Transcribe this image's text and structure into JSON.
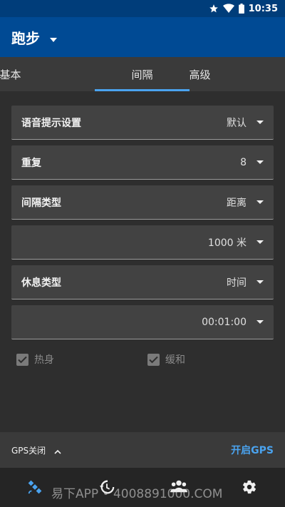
{
  "status_bar": {
    "time": "10:35"
  },
  "app_bar": {
    "title": "跑步"
  },
  "tabs": [
    {
      "label": "基本"
    },
    {
      "label": "间隔"
    },
    {
      "label": "高级"
    }
  ],
  "active_tab": "间隔",
  "form": {
    "voice_prompt": {
      "label": "语音提示设置",
      "value": "默认"
    },
    "repeat": {
      "label": "重复",
      "value": "8"
    },
    "interval_type": {
      "label": "间隔类型",
      "value": "距离"
    },
    "interval_distance": {
      "value": "1000 米"
    },
    "rest_type": {
      "label": "休息类型",
      "value": "时间"
    },
    "rest_duration": {
      "value": "00:01:00"
    }
  },
  "checkboxes": {
    "warmup": {
      "label": "热身",
      "checked": true
    },
    "cooldown": {
      "label": "缓和",
      "checked": true
    }
  },
  "gps": {
    "status": "GPS关闭",
    "enable_label": "开启GPS"
  },
  "watermark": "易下APP • 4008891000.COM",
  "colors": {
    "accent": "#4aa3ef",
    "app_bar": "#004a94",
    "status_bar": "#003d7a"
  },
  "bottom_nav": [
    "satellite-icon",
    "history-icon",
    "group-icon",
    "settings-icon"
  ]
}
